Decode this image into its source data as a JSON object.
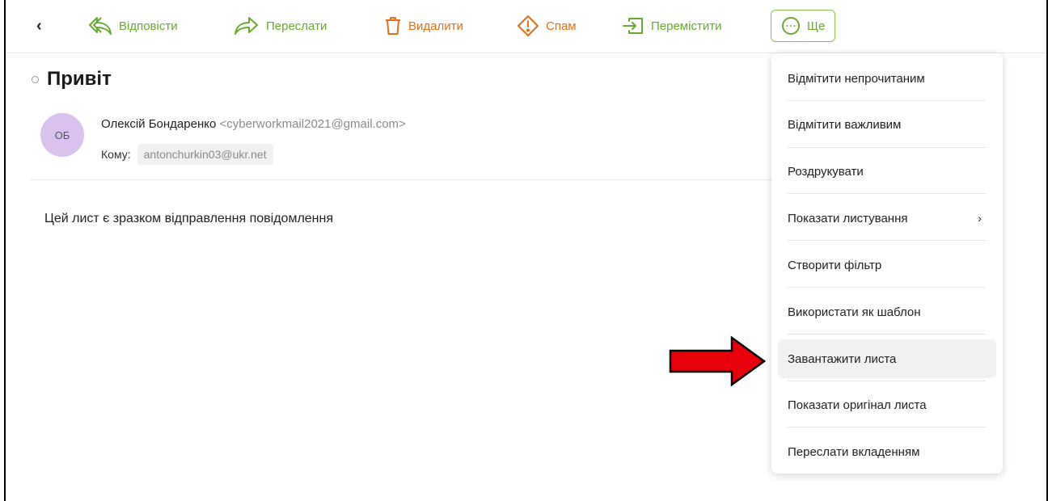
{
  "toolbar": {
    "back_glyph": "‹",
    "reply_label": "Відповісти",
    "forward_label": "Переслати",
    "delete_label": "Видалити",
    "spam_label": "Спам",
    "move_label": "Перемістити",
    "more_label": "Ще",
    "icons": [
      "reply-icon",
      "forward-icon",
      "trash-icon",
      "warning-icon",
      "move-icon",
      "more-icon"
    ],
    "colors": {
      "green": "#6aa92f",
      "orange": "#e0701a"
    }
  },
  "message": {
    "subject": "Привіт",
    "avatar_initials": "ОБ",
    "sender_name": "Олексій Бондаренко",
    "sender_email": "<cyberworkmail2021@gmail.com>",
    "to_label": "Кому:",
    "to_address": "antonchurkin03@ukr.net",
    "body": "Цей лист є зразком відправлення повідомлення"
  },
  "menu": {
    "items": [
      "Відмітити непрочитаним",
      "Відмітити важливим",
      "Роздрукувати",
      "Показати листування",
      "Створити фільтр",
      "Використати як шаблон",
      "Завантажити листа",
      "Показати оригінал листа",
      "Переслати вкладенням"
    ],
    "submenu_chevron": "›",
    "highlighted_item": "Завантажити листа"
  },
  "annotation": {
    "arrow_color": "#e8000b"
  }
}
